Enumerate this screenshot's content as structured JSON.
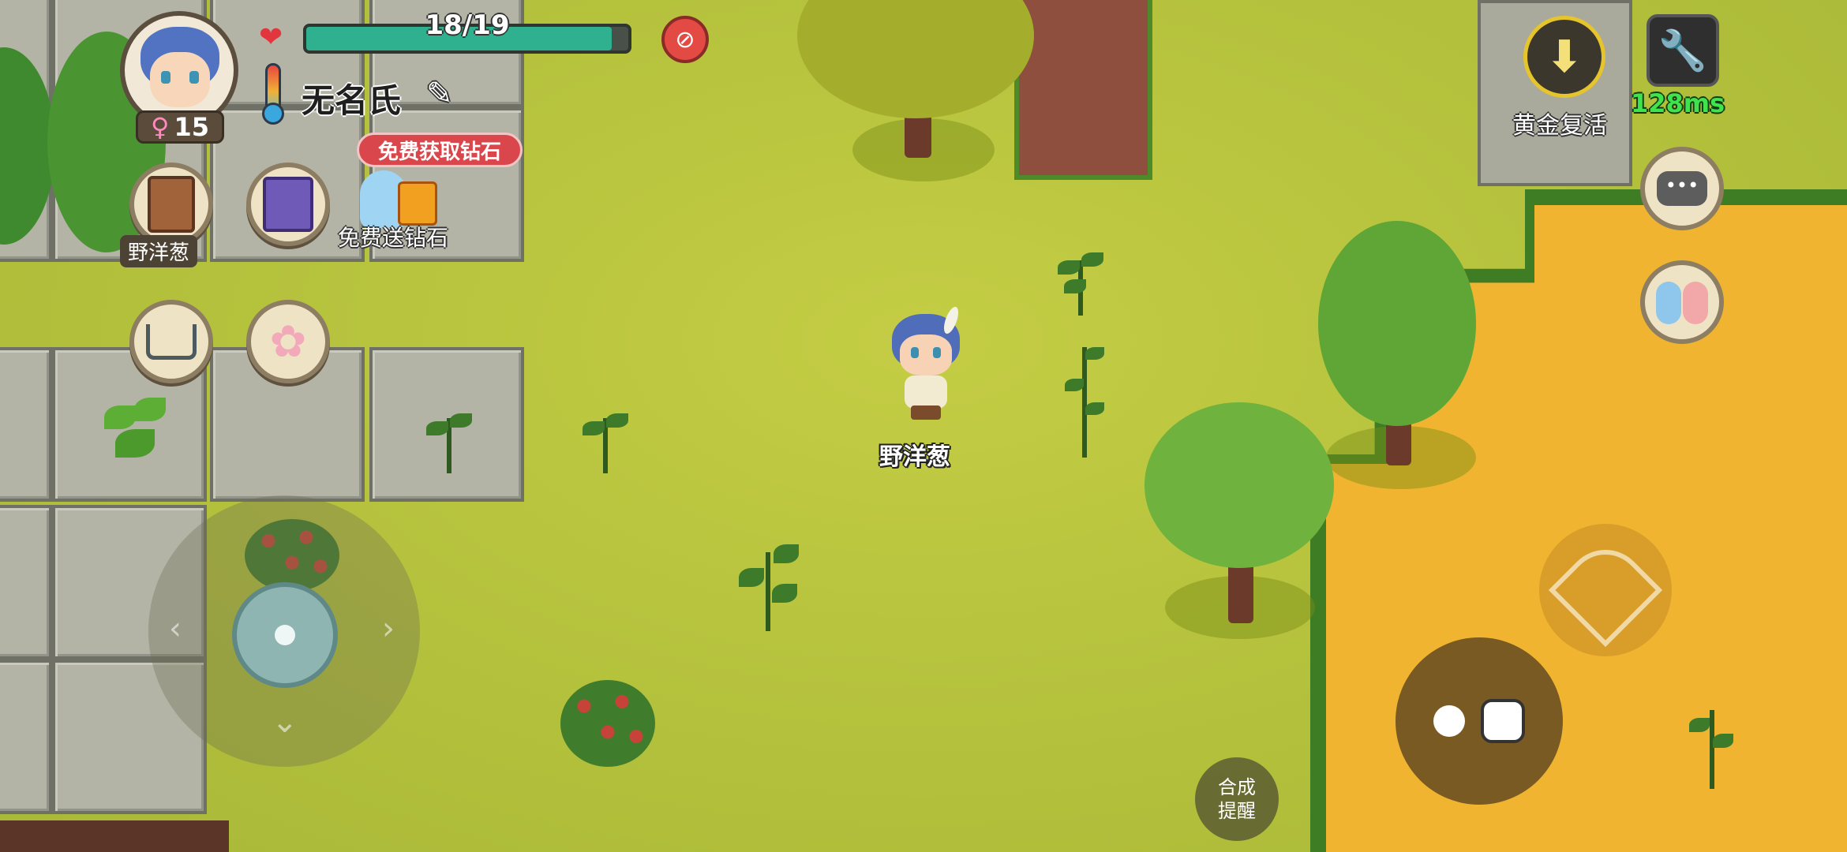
{
  "player": {
    "name": "无名氏",
    "level": "15",
    "hp_text": "18/19",
    "hp_current": 18,
    "hp_max": 19,
    "gender_symbol": "♀"
  },
  "world": {
    "character_label": "野洋葱"
  },
  "menu": {
    "item_label": "野洋葱",
    "free_diamond_badge": "免费获取钻石",
    "free_diamond_label": "免费送钻石"
  },
  "top_right": {
    "respawn_label": "黄金复活",
    "ping": "128ms"
  },
  "bottom": {
    "craft_line1": "合成",
    "craft_line2": "提醒"
  },
  "colors": {
    "hp_fill": "#2fb18f",
    "badge_red": "#d9464b",
    "ping_green": "#3fe34e",
    "respawn_gold": "#e6c42b",
    "sand": "#f0b430"
  },
  "icons": {
    "heart": "heart-icon",
    "no_mask": "no-mask-icon",
    "thermometer": "thermometer-icon",
    "edit": "pencil-icon",
    "respawn": "down-arrow-icon",
    "settings": "wrench-icon",
    "chat": "chat-bubble-icon",
    "friends": "friends-icon",
    "bow": "bow-icon",
    "grab": "grab-hand-icon"
  }
}
